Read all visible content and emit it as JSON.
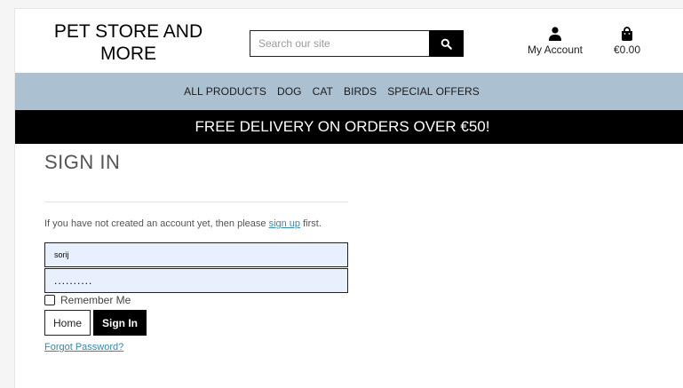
{
  "header": {
    "brand_line1": "PET STORE AND",
    "brand_line2": "MORE",
    "search_placeholder": "Search our site",
    "account_label": "My Account",
    "cart_total": "€0.00"
  },
  "nav": {
    "items": [
      "ALL PRODUCTS",
      "DOG",
      "CAT",
      "BIRDS",
      "SPECIAL OFFERS"
    ]
  },
  "banner": {
    "text": "FREE DELIVERY ON ORDERS OVER €50!"
  },
  "signin": {
    "title": "SIGN IN",
    "info_prefix": "If you have not created an account yet, then please ",
    "info_link": "sign up",
    "info_suffix": " first.",
    "username_value": "sorij",
    "password_value": "..........",
    "remember_label": "Remember Me",
    "home_button": "Home",
    "signin_button": "Sign In",
    "forgot_link": "Forgot Password?"
  },
  "icons": {
    "search": "search-icon",
    "account": "user-icon",
    "cart": "shopping-bag-icon"
  }
}
